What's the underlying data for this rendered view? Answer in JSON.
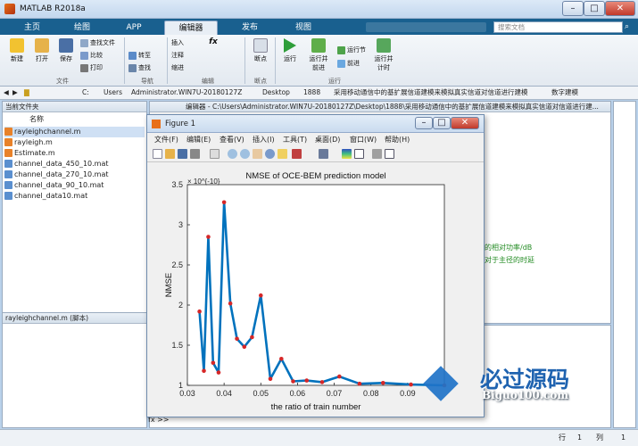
{
  "window": {
    "title": "MATLAB R2018a",
    "min": "–",
    "max": "□",
    "close": "✕"
  },
  "tabs": [
    "主页",
    "绘图",
    "APP",
    "编辑器",
    "发布",
    "视图"
  ],
  "search_placeholder": "搜索文档",
  "ribbon": {
    "file": {
      "new": "新建",
      "open": "打开",
      "save": "保存",
      "find_files": "查找文件",
      "compare": "比较",
      "print": "打印",
      "group": "文件"
    },
    "nav": {
      "go_to": "转至",
      "find": "查找",
      "group": "导航"
    },
    "edit": {
      "insert": "插入",
      "comment": "注释",
      "indent": "缩进",
      "fx": "fx",
      "group": "编辑"
    },
    "breakpoints": {
      "label": "断点",
      "group": "断点"
    },
    "run": {
      "run": "运行",
      "run_advance": "运行并\n前进",
      "run_section": "运行节",
      "advance": "前进",
      "run_time": "运行并\n计时",
      "group": "运行"
    }
  },
  "path": [
    "C:",
    "Users",
    "Administrator.WIN7U-20180127Z",
    "Desktop",
    "1888",
    "采用移动通信中的基扩展信道建模来模拟真实信道对信道进行建模",
    "数字建模"
  ],
  "current_folder": {
    "title": "当前文件夹",
    "col_name": "名称",
    "files": [
      "rayleighchannel.m",
      "rayleigh.m",
      "Estimate.m",
      "channel_data_450_10.mat",
      "channel_data_270_10.mat",
      "channel_data_90_10.mat",
      "channel_data10.mat"
    ],
    "details": "rayleighchannel.m  (脚本)"
  },
  "editor": {
    "title": "编辑器 - C:\\Users\\Administrator.WIN7U-20180127Z\\Desktop\\1888\\采用移动通信中的基扩展信道建模来模拟真实信道对信道进行建...",
    "comment1": "径的相对功率/dB",
    "comment2": "相对于主径的时延"
  },
  "figure": {
    "title": "Figure 1",
    "menu": [
      "文件(F)",
      "编辑(E)",
      "查看(V)",
      "插入(I)",
      "工具(T)",
      "桌面(D)",
      "窗口(W)",
      "帮助(H)"
    ]
  },
  "cmd_prompt": "fx >>",
  "status": {
    "row_label": "行",
    "row": "1",
    "col_label": "列",
    "col": "1"
  },
  "watermark": {
    "cn": "必过源码",
    "url": "Biguo100.com"
  },
  "colors": {
    "line": "#0072bd",
    "marker": "#d62728",
    "accent": "#19608f"
  },
  "chart_data": {
    "type": "line",
    "title": "NMSE of OCE-BEM prediction model",
    "xlabel": "the ratio of train number",
    "ylabel": "NMSE",
    "y_exponent": "× 10^{-10}",
    "xlim": [
      0.03,
      0.1
    ],
    "ylim": [
      1,
      3.5
    ],
    "xticks": [
      "0.03",
      "0.04",
      "0.05",
      "0.06",
      "0.07",
      "0.08",
      "0.09"
    ],
    "yticks": [
      "1",
      "1.5",
      "2",
      "2.5",
      "3",
      "3.5"
    ],
    "x": [
      0.0333,
      0.0345,
      0.0357,
      0.037,
      0.0385,
      0.04,
      0.0417,
      0.0435,
      0.0455,
      0.0476,
      0.05,
      0.0526,
      0.0556,
      0.0588,
      0.0625,
      0.0667,
      0.0714,
      0.0769,
      0.0833,
      0.0909,
      0.1
    ],
    "y": [
      1.92,
      1.18,
      2.85,
      1.28,
      1.16,
      3.28,
      2.02,
      1.58,
      1.48,
      1.6,
      2.12,
      1.08,
      1.33,
      1.05,
      1.06,
      1.04,
      1.11,
      1.02,
      1.03,
      1.01,
      1.0
    ]
  }
}
